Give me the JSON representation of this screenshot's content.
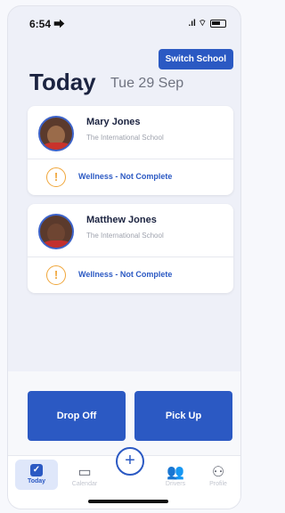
{
  "status_bar": {
    "time": "6:54 ⮕",
    "signal": ".ıl ⌔"
  },
  "header": {
    "switch_label": "Switch School",
    "title": "Today",
    "date": "Tue 29 Sep"
  },
  "students": [
    {
      "name": "Mary Jones",
      "school": "The International School",
      "wellness": "Wellness - Not Complete",
      "warn": "!"
    },
    {
      "name": "Matthew Jones",
      "school": "The International School",
      "wellness": "Wellness - Not Complete",
      "warn": "!"
    }
  ],
  "actions": {
    "drop_off": "Drop Off",
    "pick_up": "Pick Up"
  },
  "tabs": {
    "today": {
      "label": "Today",
      "icon": "✓"
    },
    "calendar": {
      "label": "Calendar",
      "icon": "▭"
    },
    "add": {
      "icon": "+"
    },
    "drivers": {
      "label": "Drivers",
      "icon": "👥"
    },
    "profile": {
      "label": "Profile",
      "icon": "⚇"
    }
  },
  "colors": {
    "accent": "#2b59c3",
    "warning": "#f0a63a"
  }
}
